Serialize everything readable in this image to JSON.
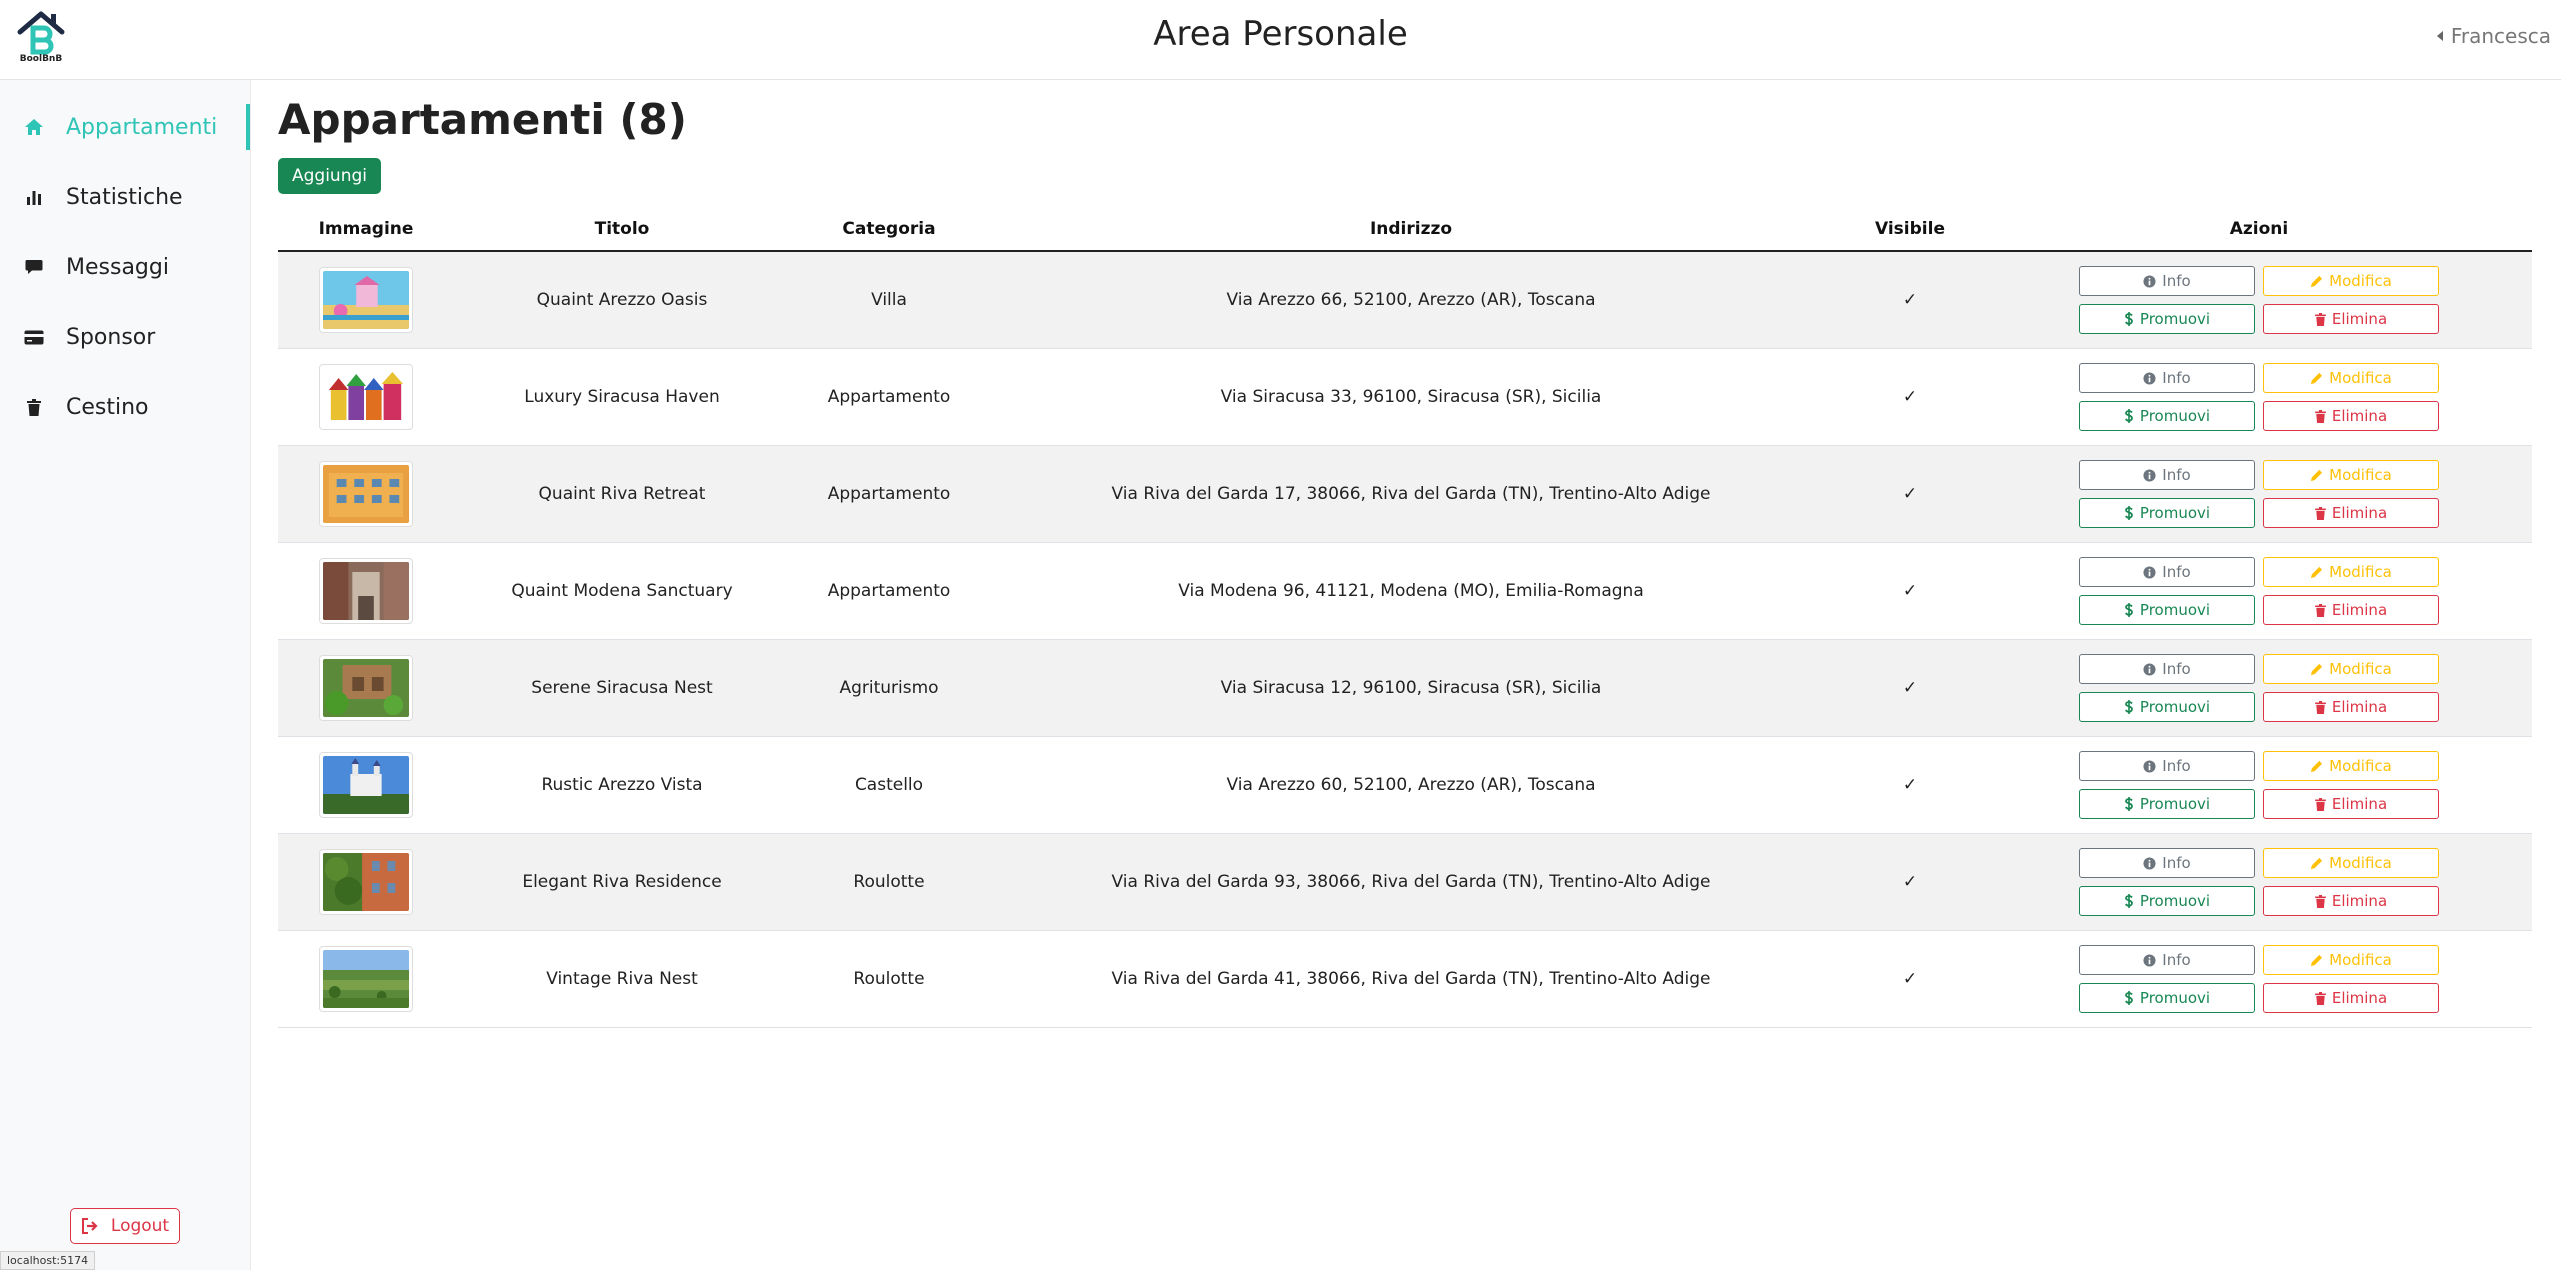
{
  "header": {
    "title": "Area Personale",
    "logo_text": "BoolBnB",
    "user_name": "Francesca"
  },
  "sidebar": {
    "items": [
      {
        "label": "Appartamenti",
        "icon": "home-icon",
        "active": true
      },
      {
        "label": "Statistiche",
        "icon": "bar-chart-icon",
        "active": false
      },
      {
        "label": "Messaggi",
        "icon": "message-icon",
        "active": false
      },
      {
        "label": "Sponsor",
        "icon": "credit-card-icon",
        "active": false
      },
      {
        "label": "Cestino",
        "icon": "trash-icon",
        "active": false
      }
    ],
    "logout_label": "Logout"
  },
  "status_url": "localhost:5174",
  "main": {
    "title": "Appartamenti (8)",
    "add_label": "Aggiungi",
    "columns": [
      "Immagine",
      "Titolo",
      "Categoria",
      "Indirizzo",
      "Visibile",
      "Azioni"
    ],
    "actions": {
      "info": "Info",
      "edit": "Modifica",
      "promote": "Promuovi",
      "delete": "Elimina"
    },
    "rows": [
      {
        "title": "Quaint Arezzo Oasis",
        "category": "Villa",
        "address": "Via Arezzo 66, 52100, Arezzo (AR), Toscana",
        "visible": "✓"
      },
      {
        "title": "Luxury Siracusa Haven",
        "category": "Appartamento",
        "address": "Via Siracusa 33, 96100, Siracusa (SR), Sicilia",
        "visible": "✓"
      },
      {
        "title": "Quaint Riva Retreat",
        "category": "Appartamento",
        "address": "Via Riva del Garda 17, 38066, Riva del Garda (TN), Trentino-Alto Adige",
        "visible": "✓"
      },
      {
        "title": "Quaint Modena Sanctuary",
        "category": "Appartamento",
        "address": "Via Modena 96, 41121, Modena (MO), Emilia-Romagna",
        "visible": "✓"
      },
      {
        "title": "Serene Siracusa Nest",
        "category": "Agriturismo",
        "address": "Via Siracusa 12, 96100, Siracusa (SR), Sicilia",
        "visible": "✓"
      },
      {
        "title": "Rustic Arezzo Vista",
        "category": "Castello",
        "address": "Via Arezzo 60, 52100, Arezzo (AR), Toscana",
        "visible": "✓"
      },
      {
        "title": "Elegant Riva Residence",
        "category": "Roulotte",
        "address": "Via Riva del Garda 93, 38066, Riva del Garda (TN), Trentino-Alto Adige",
        "visible": "✓"
      },
      {
        "title": "Vintage Riva Nest",
        "category": "Roulotte",
        "address": "Via Riva del Garda 41, 38066, Riva del Garda (TN), Trentino-Alto Adige",
        "visible": "✓"
      }
    ]
  },
  "colors": {
    "accent": "#2ec4b6",
    "success": "#198754",
    "warning": "#ffc107",
    "danger": "#dc3545",
    "secondary": "#6c757d"
  }
}
